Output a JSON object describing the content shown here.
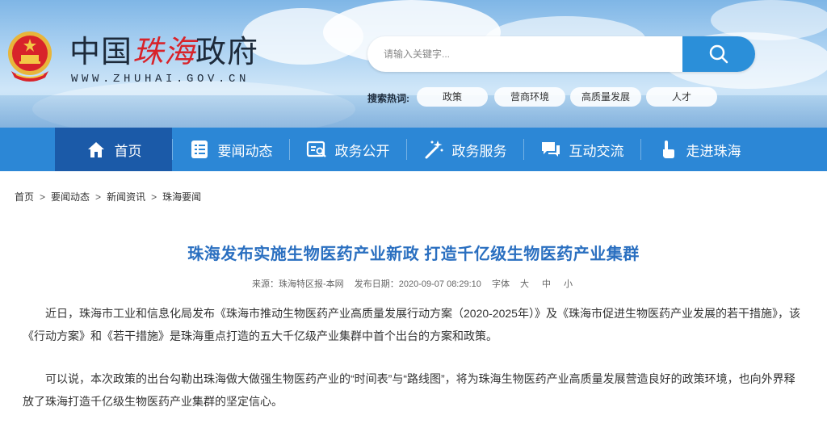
{
  "header": {
    "logo_title_part1": "中国",
    "logo_title_part2": "珠海",
    "logo_title_part3": "政府",
    "logo_url": "WWW.ZHUHAI.GOV.CN",
    "search_placeholder": "请输入关键字...",
    "hot_label": "搜索热词:",
    "hot_tags": [
      "政策",
      "营商环境",
      "高质量发展",
      "人才"
    ]
  },
  "nav": {
    "items": [
      {
        "label": "首页",
        "icon": "home-icon"
      },
      {
        "label": "要闻动态",
        "icon": "list-icon"
      },
      {
        "label": "政务公开",
        "icon": "document-search-icon"
      },
      {
        "label": "政务服务",
        "icon": "magic-wand-icon"
      },
      {
        "label": "互动交流",
        "icon": "chat-icon"
      },
      {
        "label": "走进珠海",
        "icon": "pointer-hand-icon"
      }
    ]
  },
  "breadcrumb": [
    "首页",
    "要闻动态",
    "新闻资讯",
    "珠海要闻"
  ],
  "article": {
    "title": "珠海发布实施生物医药产业新政 打造千亿级生物医药产业集群",
    "source": "来源：珠海特区报-本网",
    "published": "发布日期：2020-09-07 08:29:10",
    "font_label": "字体",
    "font_sizes": [
      "大",
      "中",
      "小"
    ],
    "paragraphs": [
      "近日，珠海市工业和信息化局发布《珠海市推动生物医药产业高质量发展行动方案（2020-2025年）》及《珠海市促进生物医药产业发展的若干措施》，该《行动方案》和《若干措施》是珠海重点打造的五大千亿级产业集群中首个出台的方案和政策。",
      "可以说，本次政策的出台勾勒出珠海做大做强生物医药产业的“时间表”与“路线图”，将为珠海生物医药产业高质量发展营造良好的政策环境，也向外界释放了珠海打造千亿级生物医药产业集群的坚定信心。"
    ]
  },
  "colors": {
    "nav_bg": "#2c87d6",
    "nav_active": "#1b5aa8",
    "title": "#2a6fc0",
    "logo_red": "#d8232a"
  }
}
